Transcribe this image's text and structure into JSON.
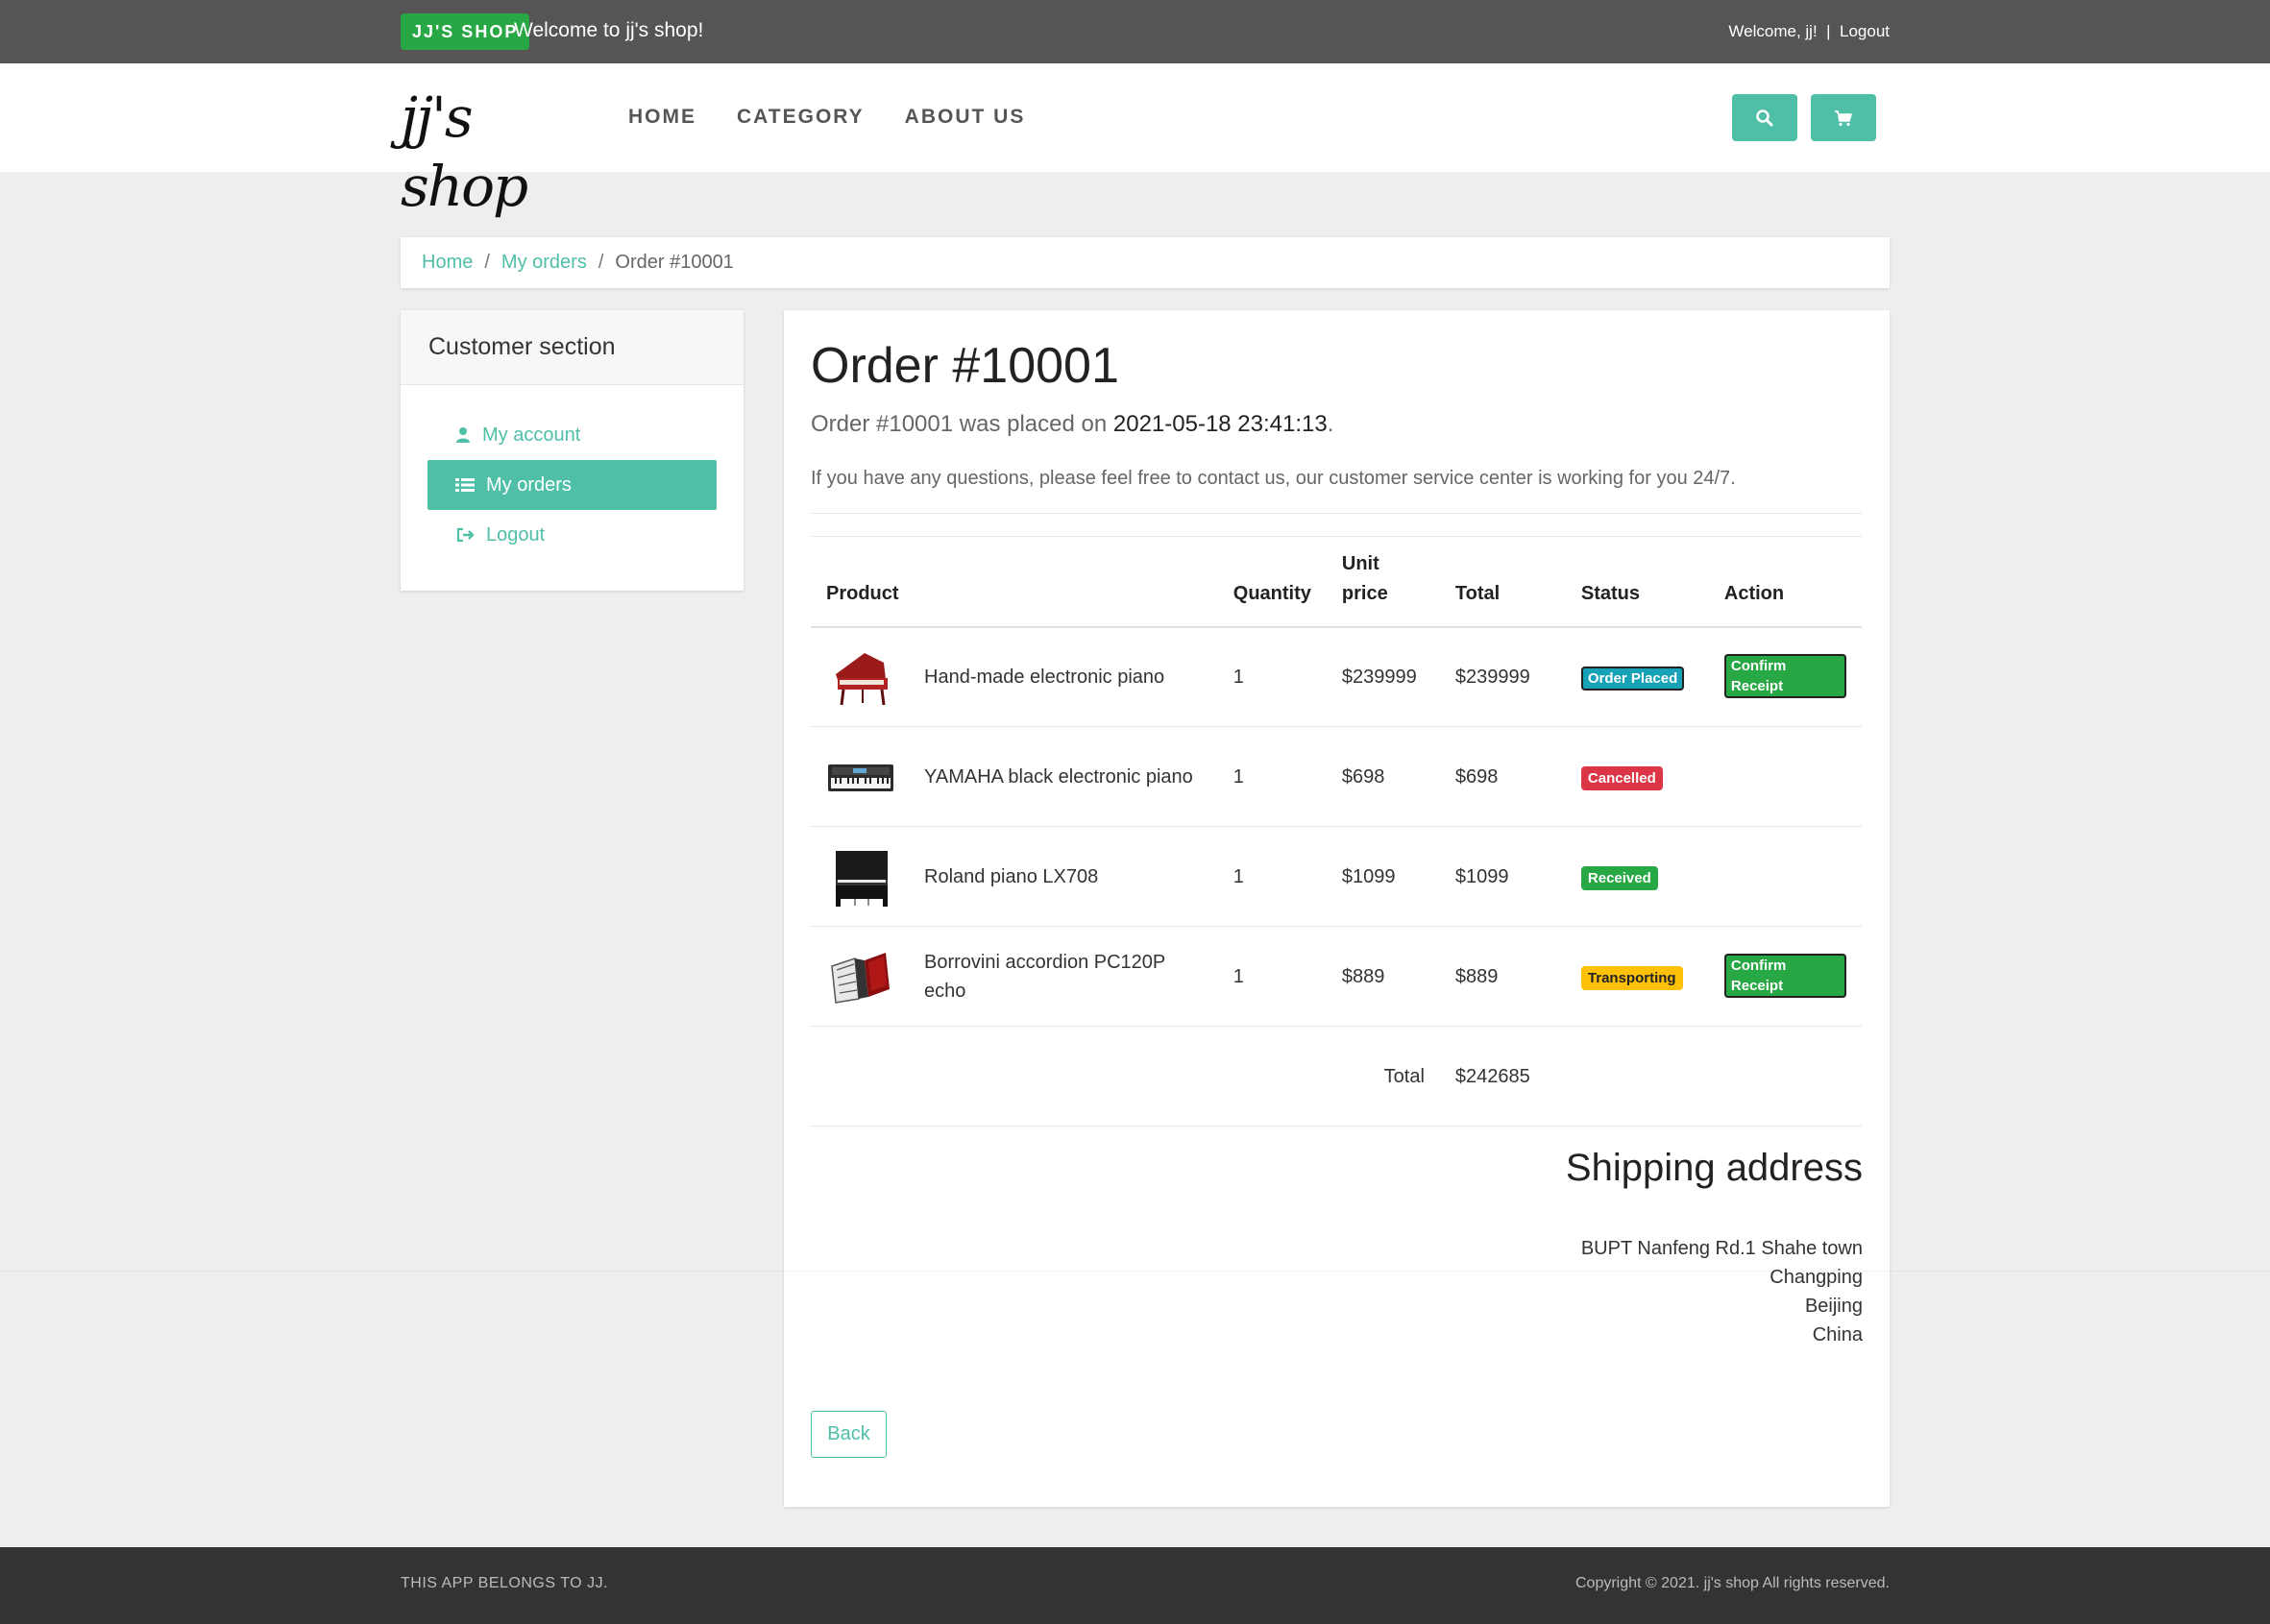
{
  "topbar": {
    "badge": "JJ'S SHOP",
    "welcome": "Welcome to jj's shop!",
    "greeting": "Welcome, jj!",
    "separator": "|",
    "logout": "Logout"
  },
  "nav": {
    "logo": "jj's shop",
    "links": [
      "HOME",
      "CATEGORY",
      "ABOUT US"
    ],
    "buttons": [
      "search-icon",
      "cart-icon"
    ]
  },
  "breadcrumb": {
    "home": "Home",
    "orders": "My orders",
    "current": "Order #10001",
    "sep": "/"
  },
  "sidebar": {
    "title": "Customer section",
    "items": [
      {
        "label": "My account",
        "icon": "user-icon"
      },
      {
        "label": "My orders",
        "icon": "list-icon",
        "active": true
      },
      {
        "label": "Logout",
        "icon": "sign-out-icon"
      }
    ]
  },
  "order": {
    "title": "Order #10001",
    "placed_prefix": "Order #10001 was placed on ",
    "placed_date": "2021-05-18 23:41:13",
    "placed_suffix": ".",
    "lead": "If you have any questions, please feel free to contact us, our customer service center is working for you 24/7.",
    "columns": {
      "product": "Product",
      "quantity": "Quantity",
      "unit_price_1": "Unit",
      "unit_price_2": "price",
      "total": "Total",
      "status": "Status",
      "action": "Action"
    },
    "rows": [
      {
        "name": "Hand-made electronic piano",
        "qty": "1",
        "unit": "$239999",
        "total": "$239999",
        "status": "Order Placed",
        "status_type": "info",
        "action": "Confirm Receipt",
        "image": "red-grand-piano"
      },
      {
        "name": "YAMAHA black electronic piano",
        "qty": "1",
        "unit": "$698",
        "total": "$698",
        "status": "Cancelled",
        "status_type": "danger",
        "action": "",
        "image": "keyboard"
      },
      {
        "name": "Roland piano LX708",
        "qty": "1",
        "unit": "$1099",
        "total": "$1099",
        "status": "Received",
        "status_type": "success",
        "action": "",
        "image": "upright-piano"
      },
      {
        "name": "Borrovini accordion PC120P echo",
        "qty": "1",
        "unit": "$889",
        "total": "$889",
        "status": "Transporting",
        "status_type": "warning",
        "action": "Confirm Receipt",
        "image": "accordion"
      }
    ],
    "total_label": "Total",
    "total_value": "$242685"
  },
  "shipping": {
    "title": "Shipping address",
    "line1": "BUPT Nanfeng Rd.1 Shahe town",
    "line2": "Changping",
    "line3": "Beijing",
    "line4": "China"
  },
  "back": "Back",
  "footer": {
    "left": "THIS APP BELONGS TO JJ.",
    "right": "Copyright © 2021. jj's shop All rights reserved."
  },
  "colors": {
    "accent": "#4fbfa8",
    "topbar": "#555555",
    "footer": "#333333",
    "success": "#28a745",
    "info": "#17a2b8",
    "danger": "#dc3545",
    "warning": "#ffc107"
  }
}
